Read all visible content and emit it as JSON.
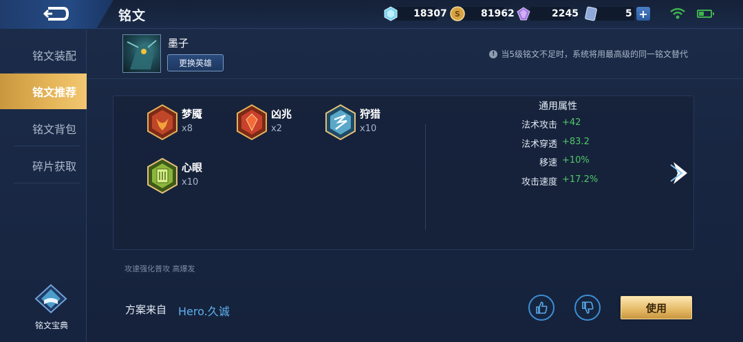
{
  "header": {
    "title": "铭文",
    "resources": [
      {
        "icon": "diamond-icon",
        "value": "18307"
      },
      {
        "icon": "gold-coin-icon",
        "value": "81962"
      },
      {
        "icon": "purple-crystal-icon",
        "value": "2245"
      },
      {
        "icon": "rune-card-icon",
        "value": "5"
      }
    ]
  },
  "sidebar": {
    "items": [
      {
        "label": "铭文装配"
      },
      {
        "label": "铭文推荐"
      },
      {
        "label": "铭文背包"
      },
      {
        "label": "碎片获取"
      }
    ],
    "codex_label": "铭文宝典"
  },
  "hero": {
    "name": "墨子",
    "change_label": "更换英雄"
  },
  "notice": "当5级铭文不足时，系统将用最高级的同一铭文替代",
  "runes": [
    {
      "name": "梦魇",
      "count": "x8",
      "color": "#c0462a"
    },
    {
      "name": "凶兆",
      "count": "x2",
      "color": "#c9412c"
    },
    {
      "name": "狩猎",
      "count": "x10",
      "color": "#5aa7c9"
    },
    {
      "name": "心眼",
      "count": "x10",
      "color": "#8bb63a"
    }
  ],
  "attributes": {
    "title": "通用属性",
    "rows": [
      {
        "key": "法术攻击",
        "value": "+42"
      },
      {
        "key": "法术穿透",
        "value": "+83.2"
      },
      {
        "key": "移速",
        "value": "+10%"
      },
      {
        "key": "攻击速度",
        "value": "+17.2%"
      }
    ]
  },
  "tags": "攻速强化普攻 高爆发",
  "source": {
    "label": "方案来自",
    "author": "Hero.久诚"
  },
  "use_label": "使用"
}
